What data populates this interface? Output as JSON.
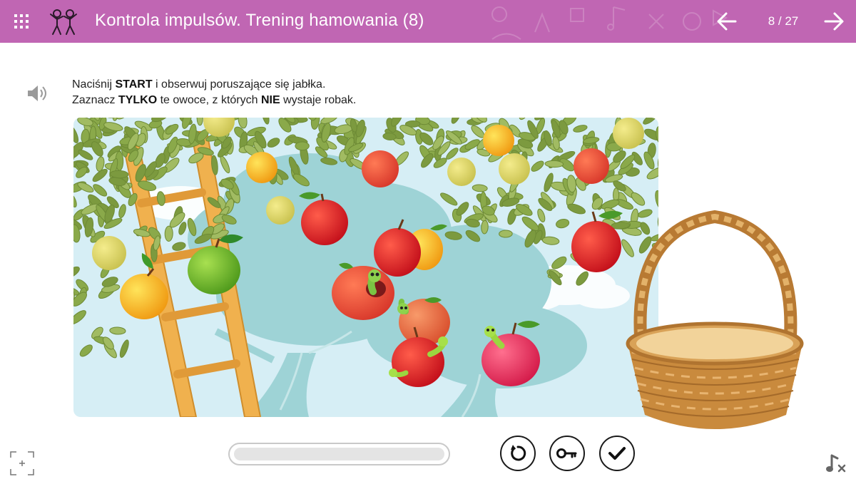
{
  "header": {
    "title": "Kontrola impulsów. Trening hamowania (8)",
    "counter": "8 / 27",
    "menu_icon": "grid-menu-icon",
    "logo_icon": "dancing-kids-icon",
    "prev_icon": "arrow-left-icon",
    "next_icon": "arrow-right-icon"
  },
  "instructions": {
    "line1_pre": "Naciśnij ",
    "line1_bold": "START",
    "line1_post": " i obserwuj poruszające się jabłka.",
    "line2_pre": "Zaznacz ",
    "line2_bold1": "TYLKO",
    "line2_mid": " te owoce, z których ",
    "line2_bold2": "NIE",
    "line2_post": " wystaje robak."
  },
  "progress": {
    "value": 0
  },
  "controls": {
    "reset_icon": "reset-icon",
    "hint_icon": "key-icon",
    "check_icon": "check-icon"
  },
  "footer": {
    "fullscreen_icon": "fullscreen-icon",
    "music_icon": "music-off-icon"
  },
  "colors": {
    "header": "#c066b3",
    "sky": "#d3ecf4",
    "tree_shadow": "#9fd2d4",
    "leaf": "#8fae52",
    "ladder": "#e6a84a",
    "basket": "#c98a3d"
  }
}
